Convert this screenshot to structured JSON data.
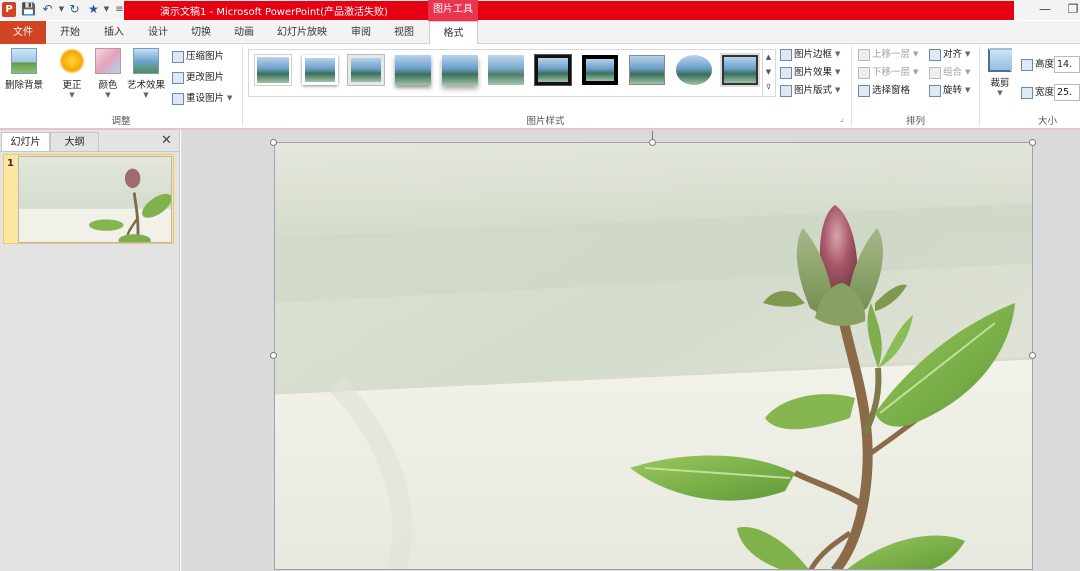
{
  "title_bar": {
    "window_title": "演示文稿1 - Microsoft PowerPoint(产品激活失败)",
    "contextual_header": "图片工具",
    "qat_icons": [
      "save-icon",
      "undo-icon",
      "redo-icon",
      "star-icon",
      "customize-icon"
    ]
  },
  "tabs": [
    "文件",
    "开始",
    "插入",
    "设计",
    "切换",
    "动画",
    "幻灯片放映",
    "审阅",
    "视图",
    "格式"
  ],
  "ribbon": {
    "adjust": {
      "remove_bg": "删除背景",
      "corrections": "更正",
      "color": "颜色",
      "artistic": "艺术效果",
      "compress": "压缩图片",
      "change_picture": "更改图片",
      "reset_picture": "重设图片",
      "group_label": "调整"
    },
    "styles": {
      "group_label": "图片样式",
      "border": "图片边框",
      "effects": "图片效果",
      "layout": "图片版式"
    },
    "arrange": {
      "bring_forward": "上移一层",
      "send_backward": "下移一层",
      "selection_pane": "选择窗格",
      "align": "对齐",
      "group": "组合",
      "rotate": "旋转",
      "group_label": "排列"
    },
    "size": {
      "crop": "裁剪",
      "height_label": "高度:",
      "height_value": "14.",
      "width_label": "宽度:",
      "width_value": "25.",
      "group_label": "大小"
    }
  },
  "left_panel": {
    "tab_slides": "幻灯片",
    "tab_outline": "大纲",
    "slide_number": "1"
  },
  "colors": {
    "title_red": "#e60012",
    "file_tab": "#d04423",
    "context_pink": "#e8364f",
    "leaf_green": "#7fb24a",
    "bud_pink": "#a8566a"
  }
}
